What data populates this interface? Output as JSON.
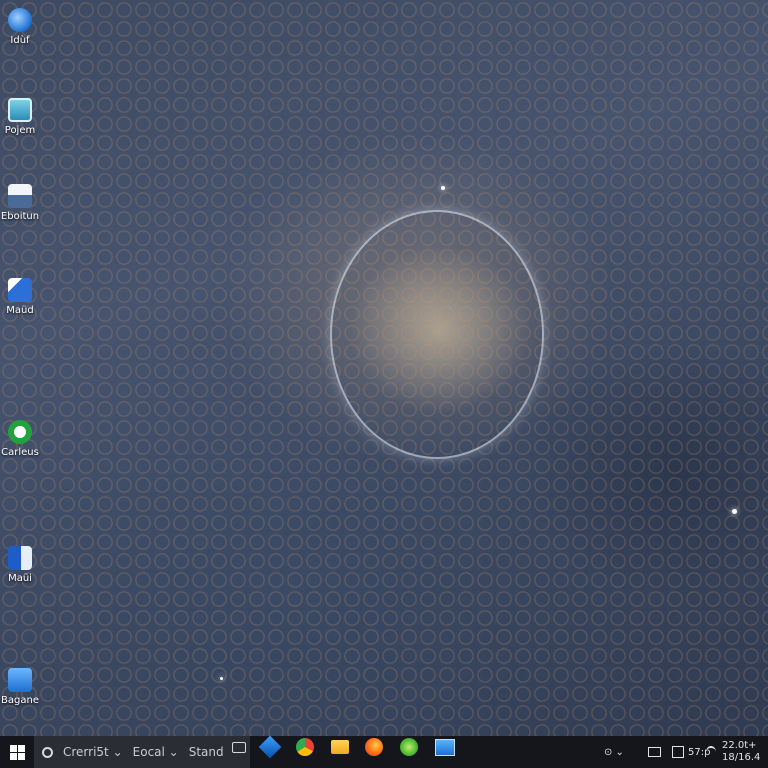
{
  "desktop": {
    "icons": [
      {
        "label": "Idùf",
        "icon": "network-icon"
      },
      {
        "label": "Pojem",
        "icon": "monitor-icon"
      },
      {
        "label": "Eboitun",
        "icon": "printer-icon"
      },
      {
        "label": "Maüd",
        "icon": "media-icon"
      },
      {
        "label": "Carleus",
        "icon": "recycle-icon"
      },
      {
        "label": "Maüi",
        "icon": "word-icon"
      },
      {
        "label": "Bagane",
        "icon": "user-icon"
      }
    ]
  },
  "taskbar": {
    "search_items": [
      "Crerri5t ⌄",
      "Eocal ⌄",
      "Stand"
    ],
    "pinned": [
      "pen-icon",
      "chrome-icon",
      "folder-icon",
      "firefox-icon",
      "green-app-icon",
      "explorer-icon"
    ],
    "tray": {
      "indicator": "⊙ ⌄",
      "lang": "57:p",
      "time": "22.0t+",
      "date": "18/16.4"
    }
  },
  "colors": {
    "taskbar_bg": "#14161b",
    "search_bg": "#2a2d33",
    "accent_blue": "#1f6fd1"
  }
}
